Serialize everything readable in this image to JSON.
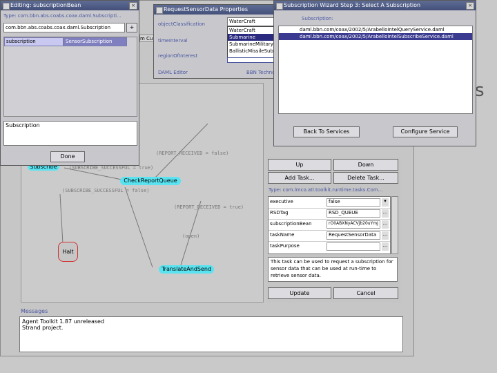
{
  "colors": {
    "desktop": "#c8c8c8",
    "titlebar": "#4e5a86",
    "node": "#59e3f0",
    "halt": "#d03030",
    "link": "#4a56a0"
  },
  "sideLetter": "s",
  "editor": {
    "title": "Editing: subscriptionBean",
    "type_label": "Type: com.bbn.abs.coabs.coax.daml.Subscripti...",
    "field_value": "com.bbn.abs.coabs.coax.daml.Subscription",
    "field_btn": "+",
    "list_items": [
      "subscription",
      "SensorSubscription"
    ],
    "text_value": "Subscription",
    "done": "Done"
  },
  "props": {
    "title": "RequestSensorData Properties",
    "label_object": "objectClassification",
    "label_time": "timeInterval",
    "label_region": "regionOfInterest",
    "combo_value": "WaterCraft",
    "options": [
      "WaterCraft",
      "Submarine",
      "SubmarineMilitary",
      "BallisticMissileSubmarine"
    ],
    "daml_editor": "DAML Editor",
    "bbn": "BBN Technologies"
  },
  "wizard": {
    "title": "Subscription Wizard Step 3: Select A Subscription",
    "subscription_label": "Subscription:",
    "items": [
      "daml.bbn.com/coax/2002/5/ArabelloIntelQueryService.daml",
      "daml.bbn.com/coax/2002/5/ArabelloIntelSubscribeService.daml"
    ],
    "back": "Back To Services",
    "configure": "Configure Service"
  },
  "under_tab": "m Cu",
  "graph": {
    "nodes": {
      "subscribe": "Subscribe",
      "check": "CheckReportQueue",
      "halt": "Halt",
      "translate": "TranslateAndSend"
    },
    "edges": {
      "report1": "(REPORT_RECEIVED = false)",
      "subscribed_true": "(SUBSCRIBE_SUCCESSFUL = true)",
      "subscribed_false": "(SUBSCRIBE_SUCCESSFUL = false)",
      "report2": "(REPORT_RECEIVED = true)",
      "open": "(open)"
    }
  },
  "tasks": {
    "up": "Up",
    "down": "Down",
    "add": "Add Task...",
    "delete": "Delete Task...",
    "type_label": "Type: com.lmco.atl.toolkit.runtime.tasks.Com...",
    "props": [
      {
        "name": "executive",
        "value": "false",
        "ctrl": "▾"
      },
      {
        "name": "RSDTag",
        "value": "RSD_QUEUE",
        "ctrl": "..."
      },
      {
        "name": "subscriptionBean",
        "value": "rO0ABXNyACVjb20uYmJ",
        "ctrl": "..."
      },
      {
        "name": "taskName",
        "value": "RequestSensorData",
        "ctrl": "..."
      },
      {
        "name": "taskPurpose",
        "value": "",
        "ctrl": "..."
      }
    ],
    "description": "This task can be used to request a subscription for sensor data that can be used at run-time to retrieve sensor data.",
    "update": "Update",
    "cancel": "Cancel"
  },
  "messages": {
    "title": "Messages",
    "lines": [
      "Agent Toolkit 1.87 unreleased",
      "Strand project."
    ]
  }
}
